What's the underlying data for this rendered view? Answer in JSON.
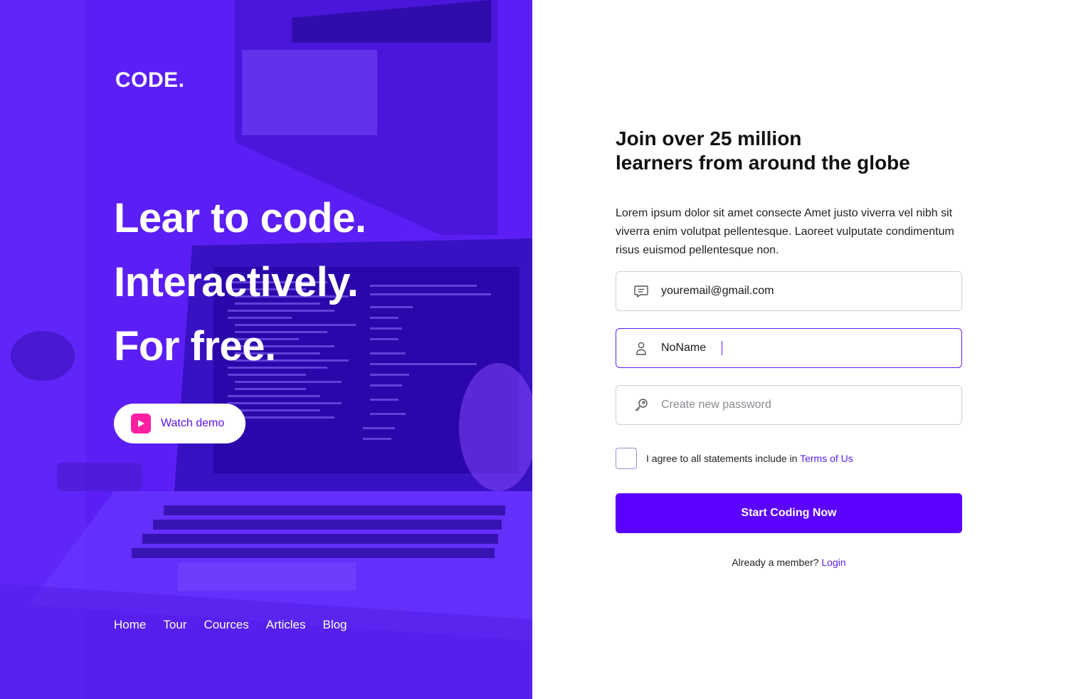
{
  "brand": {
    "logo": "CODE."
  },
  "hero": {
    "lines": [
      "Lear to code.",
      "Interactively.",
      "For free."
    ],
    "demo_button": "Watch demo",
    "nav": [
      "Home",
      "Tour",
      "Cources",
      "Articles",
      "Blog"
    ]
  },
  "form": {
    "title_line1": "Join over 25 million",
    "title_line2": "learners from around the globe",
    "description": "Lorem ipsum dolor sit amet consecte Amet justo viverra vel nibh sit viverra enim volutpat pellentesque. Laoreet vulputate condimentum risus euismod pellentesque non.",
    "email_value": "youremail@gmail.com",
    "name_value": "NoName",
    "password_placeholder": "Create new password",
    "agree_text": "I agree to all statements include in",
    "terms_link": "Terms of Us",
    "submit": "Start Coding Now",
    "member_text": "Already a member?",
    "login_link": "Login"
  },
  "colors": {
    "hero_purple": "#5b1ff5",
    "accent": "#5b00ff",
    "link": "#5a1ff0",
    "play_pink": "#ff1fa1"
  },
  "icons": {
    "email": "chat-bubble-icon",
    "name": "user-icon",
    "password": "key-icon",
    "demo": "play-icon"
  }
}
